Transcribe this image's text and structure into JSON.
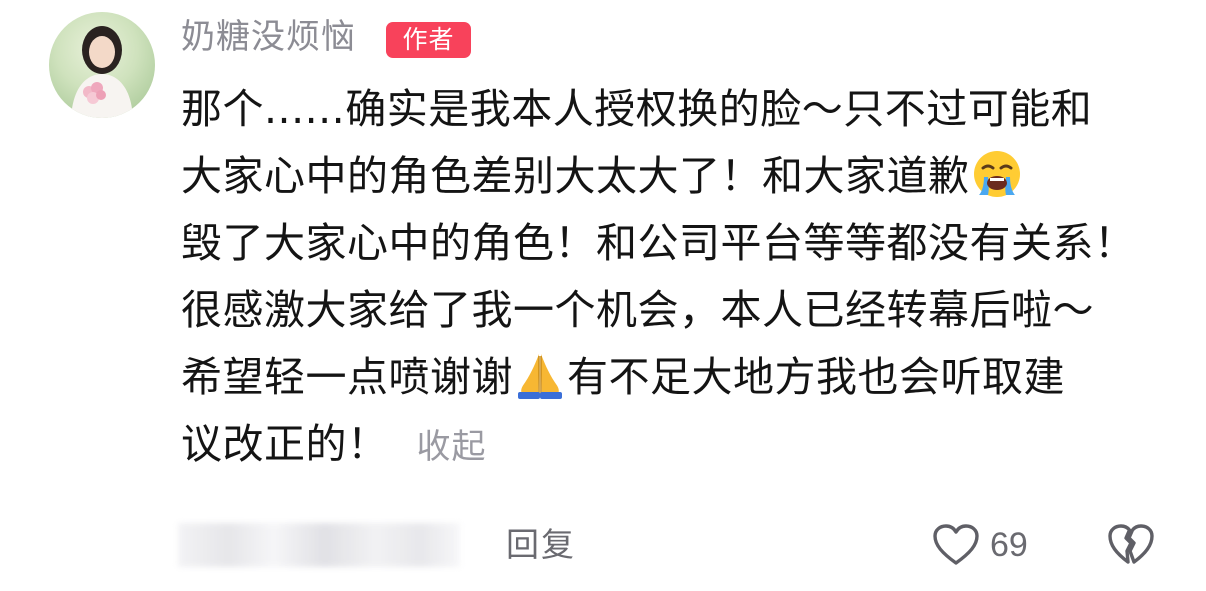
{
  "comment": {
    "username": "奶糖没烦恼",
    "author_badge": "作者",
    "lines": [
      "那个......确实是我本人授权换的脸～只不过可能和",
      "大家心中的角色差别大太大了！和大家道歉",
      "毁",
      "了大家心中的角色！和公司平台等等都没有关系！",
      "很感激大家给了我一个机会，本人已经转幕后啦～",
      "希望轻一点喷谢谢",
      "有不足大地方我也会听取建",
      "议改正的！"
    ],
    "emojis": [
      "loudly-crying-face-icon",
      "folded-hands-icon"
    ],
    "collapse_label": "收起"
  },
  "actions": {
    "reply_label": "回复",
    "like_count": "69"
  },
  "colors": {
    "badge_bg": "#f8425b",
    "username": "#8c8c94",
    "body_text": "#141414",
    "secondary": "#6a6a70"
  }
}
